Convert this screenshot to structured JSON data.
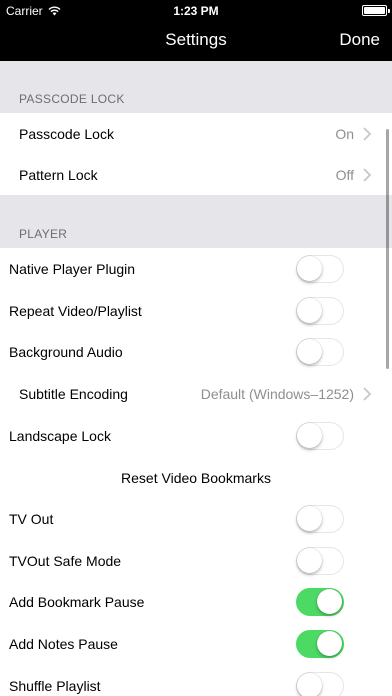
{
  "status_bar": {
    "carrier": "Carrier",
    "time": "1:23 PM"
  },
  "nav": {
    "title": "Settings",
    "done_label": "Done"
  },
  "sections": {
    "passcode": {
      "header": "PASSCODE LOCK",
      "rows": [
        {
          "label": "Passcode Lock",
          "value": "On"
        },
        {
          "label": "Pattern Lock",
          "value": "Off"
        }
      ]
    },
    "player": {
      "header": "PLAYER",
      "rows": [
        {
          "label": "Native Player Plugin",
          "toggle": false
        },
        {
          "label": "Repeat Video/Playlist",
          "toggle": false
        },
        {
          "label": "Background Audio",
          "toggle": false
        },
        {
          "label": "Subtitle Encoding",
          "value": "Default (Windows–1252)"
        },
        {
          "label": "Landscape Lock",
          "toggle": false
        },
        {
          "label": "Reset Video Bookmarks"
        },
        {
          "label": "TV Out",
          "toggle": false
        },
        {
          "label": "TVOut Safe Mode",
          "toggle": false
        },
        {
          "label": "Add Bookmark Pause",
          "toggle": true
        },
        {
          "label": "Add Notes Pause",
          "toggle": true
        },
        {
          "label": "Shuffle Playlist",
          "toggle": false
        }
      ]
    }
  },
  "colors": {
    "toggle_on": "#4cd964",
    "section_bg": "#e5e5ea",
    "nav_bg": "#000000"
  }
}
